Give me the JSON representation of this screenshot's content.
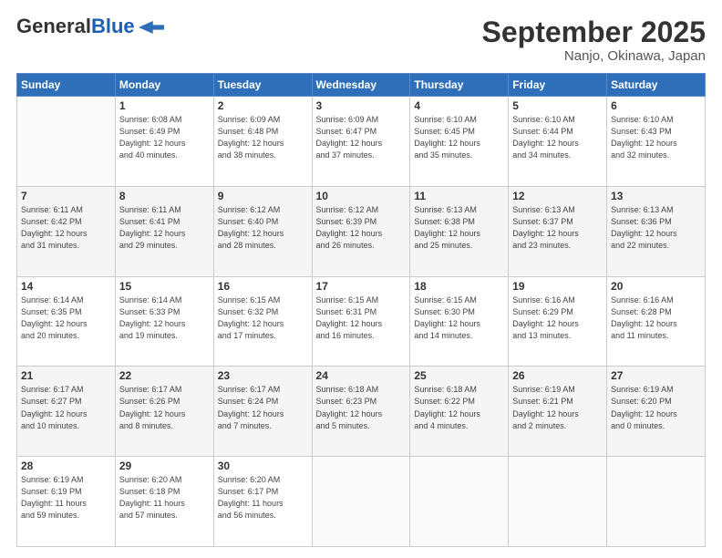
{
  "header": {
    "logo_general": "General",
    "logo_blue": "Blue",
    "title": "September 2025",
    "subtitle": "Nanjo, Okinawa, Japan"
  },
  "weekdays": [
    "Sunday",
    "Monday",
    "Tuesday",
    "Wednesday",
    "Thursday",
    "Friday",
    "Saturday"
  ],
  "weeks": [
    [
      {
        "day": "",
        "info": ""
      },
      {
        "day": "1",
        "info": "Sunrise: 6:08 AM\nSunset: 6:49 PM\nDaylight: 12 hours\nand 40 minutes."
      },
      {
        "day": "2",
        "info": "Sunrise: 6:09 AM\nSunset: 6:48 PM\nDaylight: 12 hours\nand 38 minutes."
      },
      {
        "day": "3",
        "info": "Sunrise: 6:09 AM\nSunset: 6:47 PM\nDaylight: 12 hours\nand 37 minutes."
      },
      {
        "day": "4",
        "info": "Sunrise: 6:10 AM\nSunset: 6:45 PM\nDaylight: 12 hours\nand 35 minutes."
      },
      {
        "day": "5",
        "info": "Sunrise: 6:10 AM\nSunset: 6:44 PM\nDaylight: 12 hours\nand 34 minutes."
      },
      {
        "day": "6",
        "info": "Sunrise: 6:10 AM\nSunset: 6:43 PM\nDaylight: 12 hours\nand 32 minutes."
      }
    ],
    [
      {
        "day": "7",
        "info": "Sunrise: 6:11 AM\nSunset: 6:42 PM\nDaylight: 12 hours\nand 31 minutes."
      },
      {
        "day": "8",
        "info": "Sunrise: 6:11 AM\nSunset: 6:41 PM\nDaylight: 12 hours\nand 29 minutes."
      },
      {
        "day": "9",
        "info": "Sunrise: 6:12 AM\nSunset: 6:40 PM\nDaylight: 12 hours\nand 28 minutes."
      },
      {
        "day": "10",
        "info": "Sunrise: 6:12 AM\nSunset: 6:39 PM\nDaylight: 12 hours\nand 26 minutes."
      },
      {
        "day": "11",
        "info": "Sunrise: 6:13 AM\nSunset: 6:38 PM\nDaylight: 12 hours\nand 25 minutes."
      },
      {
        "day": "12",
        "info": "Sunrise: 6:13 AM\nSunset: 6:37 PM\nDaylight: 12 hours\nand 23 minutes."
      },
      {
        "day": "13",
        "info": "Sunrise: 6:13 AM\nSunset: 6:36 PM\nDaylight: 12 hours\nand 22 minutes."
      }
    ],
    [
      {
        "day": "14",
        "info": "Sunrise: 6:14 AM\nSunset: 6:35 PM\nDaylight: 12 hours\nand 20 minutes."
      },
      {
        "day": "15",
        "info": "Sunrise: 6:14 AM\nSunset: 6:33 PM\nDaylight: 12 hours\nand 19 minutes."
      },
      {
        "day": "16",
        "info": "Sunrise: 6:15 AM\nSunset: 6:32 PM\nDaylight: 12 hours\nand 17 minutes."
      },
      {
        "day": "17",
        "info": "Sunrise: 6:15 AM\nSunset: 6:31 PM\nDaylight: 12 hours\nand 16 minutes."
      },
      {
        "day": "18",
        "info": "Sunrise: 6:15 AM\nSunset: 6:30 PM\nDaylight: 12 hours\nand 14 minutes."
      },
      {
        "day": "19",
        "info": "Sunrise: 6:16 AM\nSunset: 6:29 PM\nDaylight: 12 hours\nand 13 minutes."
      },
      {
        "day": "20",
        "info": "Sunrise: 6:16 AM\nSunset: 6:28 PM\nDaylight: 12 hours\nand 11 minutes."
      }
    ],
    [
      {
        "day": "21",
        "info": "Sunrise: 6:17 AM\nSunset: 6:27 PM\nDaylight: 12 hours\nand 10 minutes."
      },
      {
        "day": "22",
        "info": "Sunrise: 6:17 AM\nSunset: 6:26 PM\nDaylight: 12 hours\nand 8 minutes."
      },
      {
        "day": "23",
        "info": "Sunrise: 6:17 AM\nSunset: 6:24 PM\nDaylight: 12 hours\nand 7 minutes."
      },
      {
        "day": "24",
        "info": "Sunrise: 6:18 AM\nSunset: 6:23 PM\nDaylight: 12 hours\nand 5 minutes."
      },
      {
        "day": "25",
        "info": "Sunrise: 6:18 AM\nSunset: 6:22 PM\nDaylight: 12 hours\nand 4 minutes."
      },
      {
        "day": "26",
        "info": "Sunrise: 6:19 AM\nSunset: 6:21 PM\nDaylight: 12 hours\nand 2 minutes."
      },
      {
        "day": "27",
        "info": "Sunrise: 6:19 AM\nSunset: 6:20 PM\nDaylight: 12 hours\nand 0 minutes."
      }
    ],
    [
      {
        "day": "28",
        "info": "Sunrise: 6:19 AM\nSunset: 6:19 PM\nDaylight: 11 hours\nand 59 minutes."
      },
      {
        "day": "29",
        "info": "Sunrise: 6:20 AM\nSunset: 6:18 PM\nDaylight: 11 hours\nand 57 minutes."
      },
      {
        "day": "30",
        "info": "Sunrise: 6:20 AM\nSunset: 6:17 PM\nDaylight: 11 hours\nand 56 minutes."
      },
      {
        "day": "",
        "info": ""
      },
      {
        "day": "",
        "info": ""
      },
      {
        "day": "",
        "info": ""
      },
      {
        "day": "",
        "info": ""
      }
    ]
  ]
}
